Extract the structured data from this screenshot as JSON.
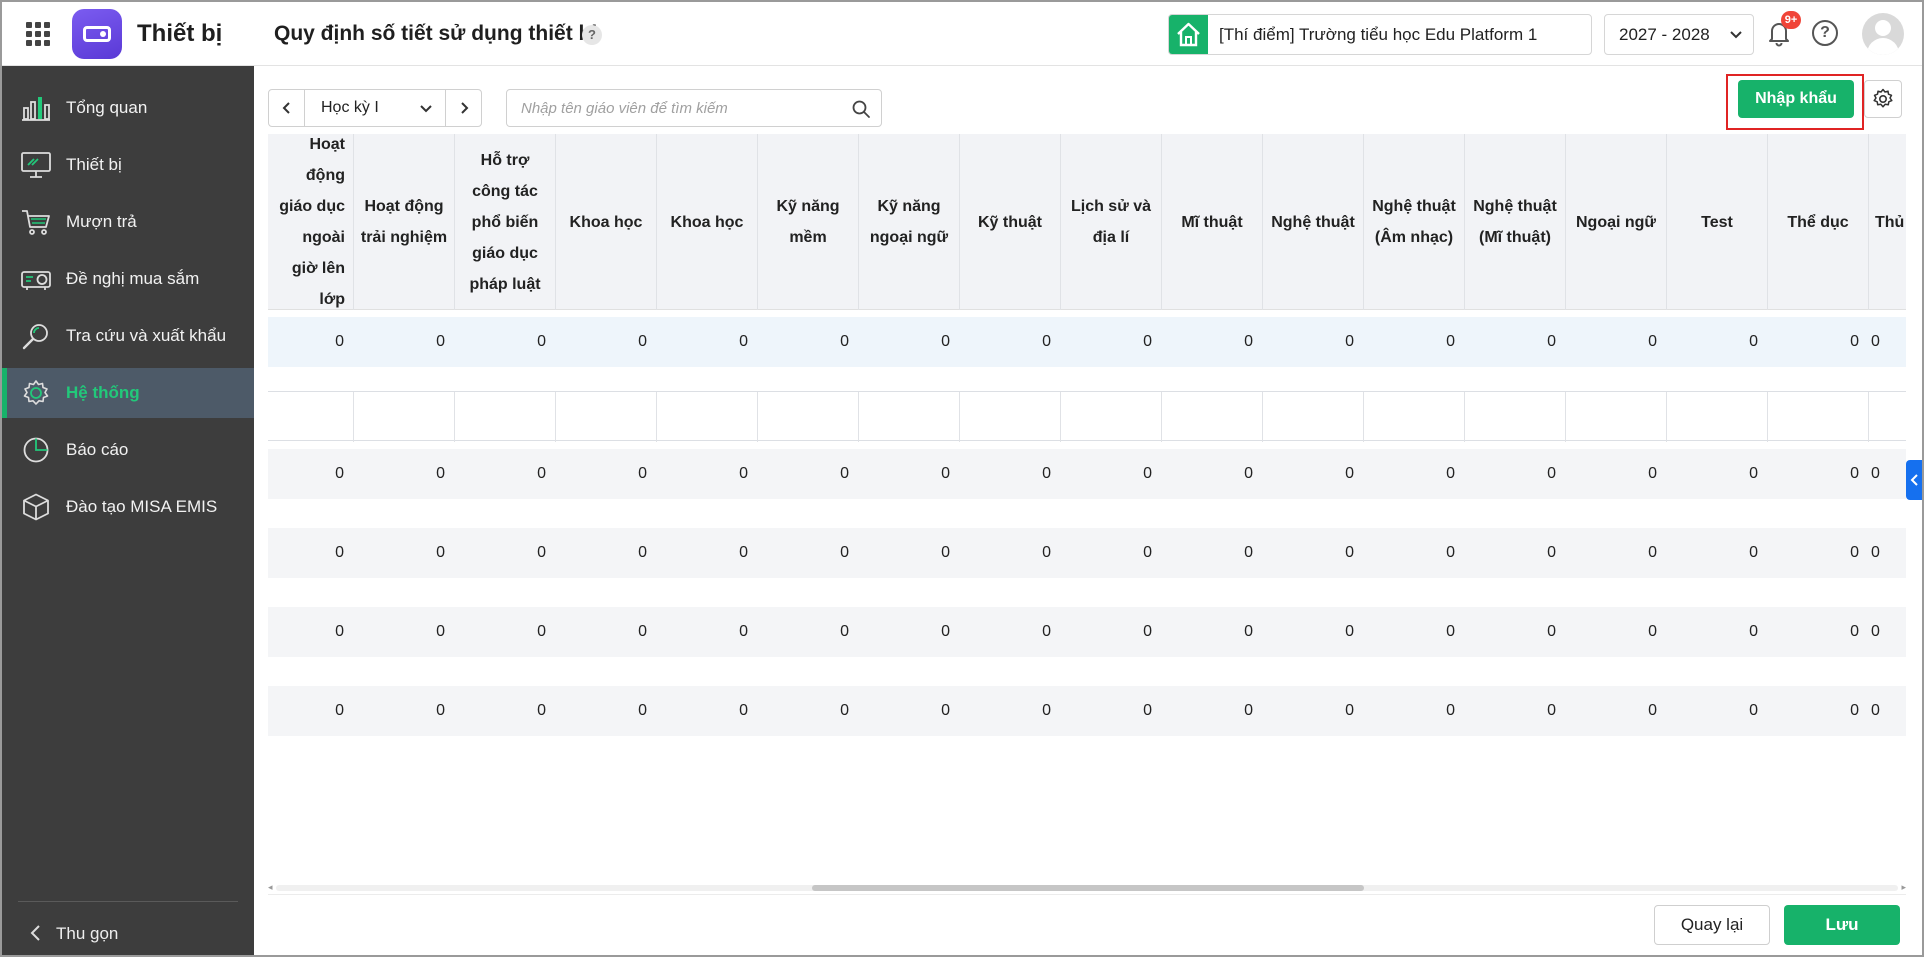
{
  "header": {
    "app_name": "Thiết bị",
    "page_title": "Quy định số tiết sử dụng thiết bị",
    "help_mark": "?",
    "school": "[Thí điểm] Trường tiểu học Edu Platform 1",
    "school_year": "2027 - 2028",
    "notification_badge": "9+",
    "help_icon_text": "?"
  },
  "sidebar": {
    "items": [
      {
        "label": "Tổng quan",
        "icon": "bar-chart-icon",
        "active": false
      },
      {
        "label": "Thiết bị",
        "icon": "monitor-icon",
        "active": false
      },
      {
        "label": "Mượn trả",
        "icon": "cart-icon",
        "active": false
      },
      {
        "label": "Đề nghị mua sắm",
        "icon": "projector-icon",
        "active": false
      },
      {
        "label": "Tra cứu và xuất khẩu",
        "icon": "search-icon",
        "active": false
      },
      {
        "label": "Hệ thống",
        "icon": "gear-icon",
        "active": true
      },
      {
        "label": "Báo cáo",
        "icon": "pie-chart-icon",
        "active": false
      },
      {
        "label": "Đào tạo MISA EMIS",
        "icon": "cube-icon",
        "active": false
      }
    ],
    "collapse_label": "Thu gọn"
  },
  "toolbar": {
    "term": "Học kỳ I",
    "search_placeholder": "Nhập tên giáo viên để tìm kiếm",
    "import_label": "Nhập khẩu"
  },
  "table": {
    "columns": [
      "Hoạt động giáo dục ngoài giờ lên lớp",
      "Hoạt động trải nghiệm",
      "Hỗ trợ công tác phổ biến giáo dục pháp luật",
      "Khoa học",
      "Khoa học",
      "Kỹ năng mềm",
      "Kỹ năng ngoại ngữ",
      "Kỹ thuật",
      "Lịch sử và địa lí",
      "Mĩ thuật",
      "Nghệ thuật",
      "Nghệ thuật (Âm nhạc)",
      "Nghệ thuật (Mĩ thuật)",
      "Ngoại ngữ",
      "Test",
      "Thể dục",
      "Thủ"
    ],
    "rows": [
      {
        "type": "value",
        "values": [
          "0",
          "0",
          "0",
          "0",
          "0",
          "0",
          "0",
          "0",
          "0",
          "0",
          "0",
          "0",
          "0",
          "0",
          "0",
          "0",
          "0"
        ]
      },
      {
        "type": "empty",
        "values": [
          "",
          "",
          "",
          "",
          "",
          "",
          "",
          "",
          "",
          "",
          "",
          "",
          "",
          "",
          "",
          "",
          ""
        ]
      },
      {
        "type": "value",
        "values": [
          "0",
          "0",
          "0",
          "0",
          "0",
          "0",
          "0",
          "0",
          "0",
          "0",
          "0",
          "0",
          "0",
          "0",
          "0",
          "0",
          "0"
        ]
      },
      {
        "type": "value",
        "values": [
          "0",
          "0",
          "0",
          "0",
          "0",
          "0",
          "0",
          "0",
          "0",
          "0",
          "0",
          "0",
          "0",
          "0",
          "0",
          "0",
          "0"
        ]
      },
      {
        "type": "value",
        "values": [
          "0",
          "0",
          "0",
          "0",
          "0",
          "0",
          "0",
          "0",
          "0",
          "0",
          "0",
          "0",
          "0",
          "0",
          "0",
          "0",
          "0"
        ]
      },
      {
        "type": "value",
        "values": [
          "0",
          "0",
          "0",
          "0",
          "0",
          "0",
          "0",
          "0",
          "0",
          "0",
          "0",
          "0",
          "0",
          "0",
          "0",
          "0",
          "0"
        ]
      }
    ]
  },
  "footer": {
    "back_label": "Quay lại",
    "save_label": "Lưu"
  },
  "colors": {
    "accent": "#17b26a",
    "sidebar_bg": "#3d3d3d",
    "sidebar_active_bg": "#4d5a68",
    "highlight_border": "#e02424",
    "badge": "#f04438",
    "side_tab": "#1570ef"
  }
}
